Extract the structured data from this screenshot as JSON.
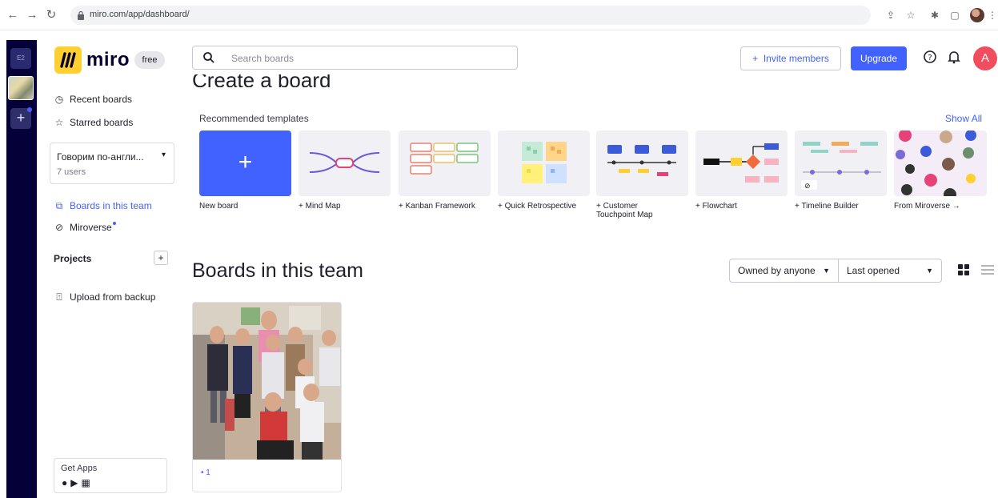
{
  "browser": {
    "url": "miro.com/app/dashboard/"
  },
  "rail": {
    "team_initials": "E2"
  },
  "app": {
    "logo_text": "miro",
    "plan_badge": "free"
  },
  "sidebar": {
    "recent_boards": "Recent boards",
    "starred_boards": "Starred boards",
    "team_name": "Говорим по-англи...",
    "team_users": "7 users",
    "boards_in_team": "Boards in this team",
    "miroverse": "Miroverse",
    "projects": "Projects",
    "upload_backup": "Upload from backup",
    "get_apps": "Get Apps"
  },
  "header": {
    "search_placeholder": "Search boards",
    "invite_label": "Invite members",
    "upgrade_label": "Upgrade",
    "avatar_initial": "A"
  },
  "templates": {
    "heading": "Create a board",
    "section_label": "Recommended templates",
    "show_all": "Show All",
    "items": [
      {
        "label": "New board"
      },
      {
        "label": "+ Mind Map"
      },
      {
        "label": "+ Kanban Framework"
      },
      {
        "label": "+ Quick Retrospective"
      },
      {
        "label": "+ Customer Touchpoint Map"
      },
      {
        "label": "+ Flowchart"
      },
      {
        "label": "+ Timeline Builder"
      },
      {
        "label": "From Miroverse →"
      }
    ]
  },
  "boards": {
    "title": "Boards in this team",
    "owner_filter": "Owned by anyone",
    "sort": "Last opened",
    "cards": [
      {
        "meta": "• 1"
      }
    ]
  },
  "colors": {
    "accent": "#4262ff",
    "rail": "#050038",
    "logo_yellow": "#ffd02f",
    "avatar": "#f24d5e"
  }
}
